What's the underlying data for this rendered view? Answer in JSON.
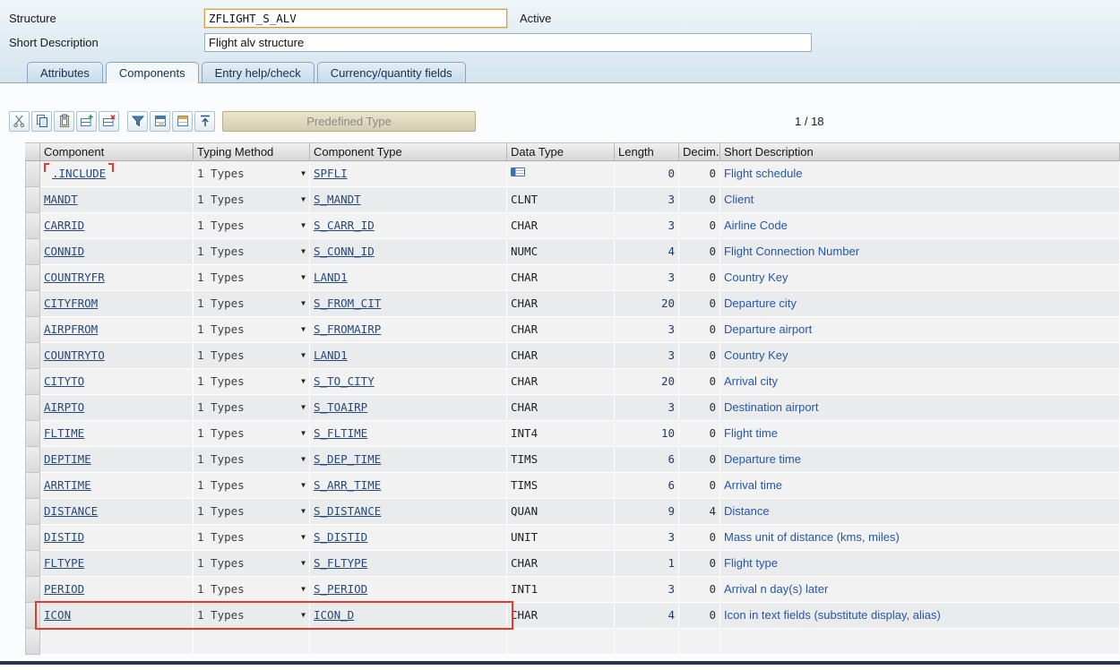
{
  "header": {
    "structure_label": "Structure",
    "structure_value": "ZFLIGHT_S_ALV",
    "status": "Active",
    "short_description_label": "Short Description",
    "short_description_value": "Flight alv structure"
  },
  "tabs": [
    {
      "label": "Attributes",
      "active": false
    },
    {
      "label": "Components",
      "active": true
    },
    {
      "label": "Entry help/check",
      "active": false
    },
    {
      "label": "Currency/quantity fields",
      "active": false
    }
  ],
  "toolbar": {
    "icon_groups": [
      [
        "cut-icon",
        "copy-icon",
        "paste-icon",
        "insert-row-icon",
        "delete-row-icon"
      ],
      [
        "filter-icon",
        "expand-include-icon",
        "collapse-include-icon",
        "scroll-top-icon"
      ]
    ],
    "predefined_type_label": "Predefined Type",
    "position_indicator": "1 / 18"
  },
  "table": {
    "columns": [
      "Component",
      "Typing Method",
      "Component Type",
      "Data Type",
      "Length",
      "Decim...",
      "Short Description"
    ],
    "rows": [
      {
        "component": ".INCLUDE",
        "typing_method": "1 Types",
        "component_type": "SPFLI",
        "data_type": "",
        "data_type_icon": true,
        "include": true,
        "highlighted": false,
        "length": "0",
        "decimals": "0",
        "short_description": "Flight schedule"
      },
      {
        "component": "MANDT",
        "typing_method": "1 Types",
        "component_type": "S_MANDT",
        "data_type": "CLNT",
        "data_type_icon": false,
        "include": false,
        "highlighted": false,
        "length": "3",
        "decimals": "0",
        "short_description": "Client"
      },
      {
        "component": "CARRID",
        "typing_method": "1 Types",
        "component_type": "S_CARR_ID",
        "data_type": "CHAR",
        "data_type_icon": false,
        "include": false,
        "highlighted": false,
        "length": "3",
        "decimals": "0",
        "short_description": "Airline Code"
      },
      {
        "component": "CONNID",
        "typing_method": "1 Types",
        "component_type": "S_CONN_ID",
        "data_type": "NUMC",
        "data_type_icon": false,
        "include": false,
        "highlighted": false,
        "length": "4",
        "decimals": "0",
        "short_description": "Flight Connection Number"
      },
      {
        "component": "COUNTRYFR",
        "typing_method": "1 Types",
        "component_type": "LAND1",
        "data_type": "CHAR",
        "data_type_icon": false,
        "include": false,
        "highlighted": false,
        "length": "3",
        "decimals": "0",
        "short_description": "Country Key"
      },
      {
        "component": "CITYFROM",
        "typing_method": "1 Types",
        "component_type": "S_FROM_CIT",
        "data_type": "CHAR",
        "data_type_icon": false,
        "include": false,
        "highlighted": false,
        "length": "20",
        "decimals": "0",
        "short_description": "Departure city"
      },
      {
        "component": "AIRPFROM",
        "typing_method": "1 Types",
        "component_type": "S_FROMAIRP",
        "data_type": "CHAR",
        "data_type_icon": false,
        "include": false,
        "highlighted": false,
        "length": "3",
        "decimals": "0",
        "short_description": "Departure airport"
      },
      {
        "component": "COUNTRYTO",
        "typing_method": "1 Types",
        "component_type": "LAND1",
        "data_type": "CHAR",
        "data_type_icon": false,
        "include": false,
        "highlighted": false,
        "length": "3",
        "decimals": "0",
        "short_description": "Country Key"
      },
      {
        "component": "CITYTO",
        "typing_method": "1 Types",
        "component_type": "S_TO_CITY",
        "data_type": "CHAR",
        "data_type_icon": false,
        "include": false,
        "highlighted": false,
        "length": "20",
        "decimals": "0",
        "short_description": "Arrival city"
      },
      {
        "component": "AIRPTO",
        "typing_method": "1 Types",
        "component_type": "S_TOAIRP",
        "data_type": "CHAR",
        "data_type_icon": false,
        "include": false,
        "highlighted": false,
        "length": "3",
        "decimals": "0",
        "short_description": "Destination airport"
      },
      {
        "component": "FLTIME",
        "typing_method": "1 Types",
        "component_type": "S_FLTIME",
        "data_type": "INT4",
        "data_type_icon": false,
        "include": false,
        "highlighted": false,
        "length": "10",
        "decimals": "0",
        "short_description": "Flight time"
      },
      {
        "component": "DEPTIME",
        "typing_method": "1 Types",
        "component_type": "S_DEP_TIME",
        "data_type": "TIMS",
        "data_type_icon": false,
        "include": false,
        "highlighted": false,
        "length": "6",
        "decimals": "0",
        "short_description": "Departure time"
      },
      {
        "component": "ARRTIME",
        "typing_method": "1 Types",
        "component_type": "S_ARR_TIME",
        "data_type": "TIMS",
        "data_type_icon": false,
        "include": false,
        "highlighted": false,
        "length": "6",
        "decimals": "0",
        "short_description": "Arrival time"
      },
      {
        "component": "DISTANCE",
        "typing_method": "1 Types",
        "component_type": "S_DISTANCE",
        "data_type": "QUAN",
        "data_type_icon": false,
        "include": false,
        "highlighted": false,
        "length": "9",
        "decimals": "4",
        "short_description": "Distance"
      },
      {
        "component": "DISTID",
        "typing_method": "1 Types",
        "component_type": "S_DISTID",
        "data_type": "UNIT",
        "data_type_icon": false,
        "include": false,
        "highlighted": false,
        "length": "3",
        "decimals": "0",
        "short_description": "Mass unit of distance (kms, miles)"
      },
      {
        "component": "FLTYPE",
        "typing_method": "1 Types",
        "component_type": "S_FLTYPE",
        "data_type": "CHAR",
        "data_type_icon": false,
        "include": false,
        "highlighted": false,
        "length": "1",
        "decimals": "0",
        "short_description": "Flight type"
      },
      {
        "component": "PERIOD",
        "typing_method": "1 Types",
        "component_type": "S_PERIOD",
        "data_type": "INT1",
        "data_type_icon": false,
        "include": false,
        "highlighted": false,
        "length": "3",
        "decimals": "0",
        "short_description": "Arrival n day(s) later"
      },
      {
        "component": "ICON",
        "typing_method": "1 Types",
        "component_type": "ICON_D",
        "data_type": "CHAR",
        "data_type_icon": false,
        "include": false,
        "highlighted": true,
        "length": "4",
        "decimals": "0",
        "short_description": "Icon in text fields (substitute display, alias)"
      }
    ]
  },
  "colors": {
    "highlight_border": "#e23b2e",
    "link_text": "#264a78",
    "description_text": "#2458a8"
  }
}
